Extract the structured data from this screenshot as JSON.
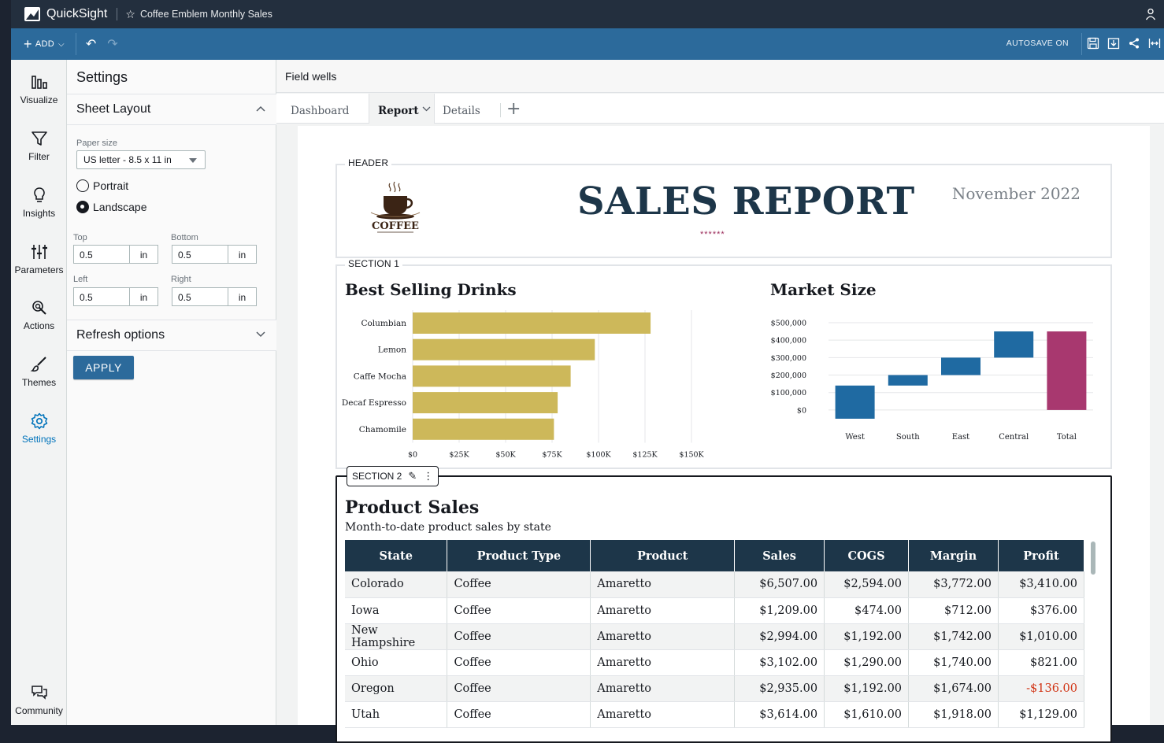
{
  "app": {
    "name": "QuickSight",
    "analysis_name": "Coffee Emblem Monthly Sales"
  },
  "toolbar": {
    "add_label": "ADD",
    "autosave_label": "AUTOSAVE ON"
  },
  "rail": {
    "items": [
      {
        "label": "Visualize",
        "icon": "bar-chart-icon"
      },
      {
        "label": "Filter",
        "icon": "filter-icon"
      },
      {
        "label": "Insights",
        "icon": "lightbulb-icon"
      },
      {
        "label": "Parameters",
        "icon": "sliders-icon"
      },
      {
        "label": "Actions",
        "icon": "cursor-click-icon"
      },
      {
        "label": "Themes",
        "icon": "brush-icon"
      },
      {
        "label": "Settings",
        "icon": "gear-icon"
      },
      {
        "label": "Community",
        "icon": "chat-icon"
      }
    ],
    "active": "Settings"
  },
  "settings": {
    "title": "Settings",
    "sheet_layout": "Sheet Layout",
    "paper_size_label": "Paper size",
    "paper_size_value": "US letter - 8.5 x 11 in",
    "orientation": {
      "portrait": "Portrait",
      "landscape": "Landscape",
      "selected": "Landscape"
    },
    "margins": {
      "top_label": "Top",
      "top_value": "0.5",
      "bottom_label": "Bottom",
      "bottom_value": "0.5",
      "left_label": "Left",
      "left_value": "0.5",
      "right_label": "Right",
      "right_value": "0.5",
      "unit": "in"
    },
    "refresh_options": "Refresh options",
    "apply_label": "APPLY"
  },
  "main": {
    "field_wells": "Field wells",
    "tabs": [
      {
        "label": "Dashboard"
      },
      {
        "label": "Report"
      },
      {
        "label": "Details"
      }
    ],
    "active_tab": "Report"
  },
  "report": {
    "header_tag": "HEADER",
    "title": "SALES REPORT",
    "stars": "******",
    "date": "November 2022",
    "logo_text": "COFFEE",
    "section1_tag": "SECTION 1",
    "section2_tag": "SECTION 2",
    "best_selling_title": "Best Selling Drinks",
    "market_size_title": "Market Size",
    "product_sales_title": "Product Sales",
    "product_sales_subtitle": "Month-to-date product sales by state"
  },
  "chart_data": [
    {
      "type": "bar",
      "orientation": "horizontal",
      "title": "Best Selling Drinks",
      "categories": [
        "Columbian",
        "Lemon",
        "Caffe Mocha",
        "Decaf Espresso",
        "Chamomile"
      ],
      "values": [
        128000,
        98000,
        85000,
        78000,
        76000
      ],
      "xticks": [
        "$0",
        "$25K",
        "$50K",
        "$75K",
        "$100K",
        "$125K",
        "$150K"
      ],
      "xlim": [
        0,
        150000
      ],
      "color": "#cdb85a"
    },
    {
      "type": "bar",
      "variant": "waterfall",
      "title": "Market Size",
      "categories": [
        "West",
        "South",
        "East",
        "Central",
        "Total"
      ],
      "values": [
        140000,
        60000,
        100000,
        150000,
        450000
      ],
      "yticks": [
        "$500,000",
        "$400,000",
        "$300,000",
        "$200,000",
        "$100,000",
        "$0"
      ],
      "ylim": [
        -50000,
        500000
      ],
      "colors": {
        "step": "#1f6aa2",
        "total": "#a8386f"
      }
    }
  ],
  "table": {
    "columns": [
      "State",
      "Product Type",
      "Product",
      "Sales",
      "COGS",
      "Margin",
      "Profit"
    ],
    "rows": [
      [
        "Colorado",
        "Coffee",
        "Amaretto",
        "$6,507.00",
        "$2,594.00",
        "$3,772.00",
        "$3,410.00"
      ],
      [
        "Iowa",
        "Coffee",
        "Amaretto",
        "$1,209.00",
        "$474.00",
        "$712.00",
        "$376.00"
      ],
      [
        "New Hampshire",
        "Coffee",
        "Amaretto",
        "$2,994.00",
        "$1,192.00",
        "$1,742.00",
        "$1,010.00"
      ],
      [
        "Ohio",
        "Coffee",
        "Amaretto",
        "$3,102.00",
        "$1,290.00",
        "$1,740.00",
        "$821.00"
      ],
      [
        "Oregon",
        "Coffee",
        "Amaretto",
        "$2,935.00",
        "$1,192.00",
        "$1,674.00",
        "-$136.00"
      ],
      [
        "Utah",
        "Coffee",
        "Amaretto",
        "$3,614.00",
        "$1,610.00",
        "$1,918.00",
        "$1,129.00"
      ]
    ]
  },
  "colors": {
    "brand_dark": "#232f3e",
    "toolbar_blue": "#2c6a9b",
    "report_navy": "#1d3649",
    "negative": "#d13212"
  }
}
